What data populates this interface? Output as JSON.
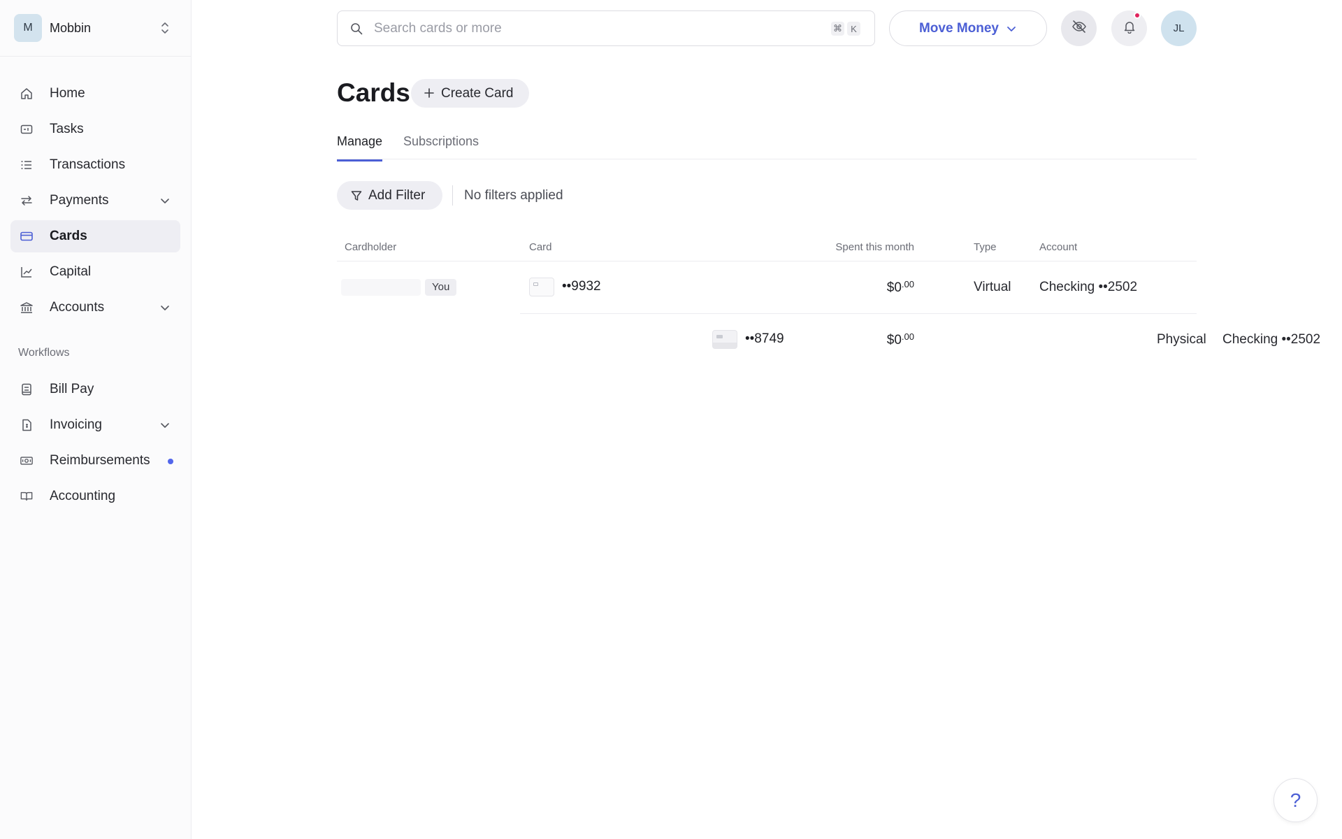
{
  "org": {
    "initial": "M",
    "name": "Mobbin"
  },
  "sidebar": {
    "items": [
      {
        "label": "Home",
        "icon": "home-icon"
      },
      {
        "label": "Tasks",
        "icon": "tasks-icon"
      },
      {
        "label": "Transactions",
        "icon": "list-icon"
      },
      {
        "label": "Payments",
        "icon": "arrows-icon",
        "expandable": true
      },
      {
        "label": "Cards",
        "icon": "card-icon",
        "active": true
      },
      {
        "label": "Capital",
        "icon": "chart-line-icon"
      },
      {
        "label": "Accounts",
        "icon": "bank-icon",
        "expandable": true
      }
    ],
    "section_label": "Workflows",
    "workflows": [
      {
        "label": "Bill Pay",
        "icon": "bill-icon"
      },
      {
        "label": "Invoicing",
        "icon": "invoice-icon",
        "expandable": true
      },
      {
        "label": "Reimbursements",
        "icon": "reimburse-icon",
        "badge_dot": true
      },
      {
        "label": "Accounting",
        "icon": "book-icon"
      }
    ]
  },
  "topbar": {
    "search_placeholder": "Search cards or more",
    "shortcut_keys": [
      "⌘",
      "K"
    ],
    "move_money_label": "Move Money",
    "user_initials": "JL"
  },
  "page": {
    "title": "Cards",
    "create_button": "Create Card",
    "tabs": [
      "Manage",
      "Subscriptions"
    ],
    "active_tab": "Manage",
    "filter_button": "Add Filter",
    "filter_status": "No filters applied"
  },
  "table": {
    "columns": [
      "Cardholder",
      "Card",
      "Spent this month",
      "Type",
      "Account"
    ],
    "rows": [
      {
        "cardholder_badge": "You",
        "card": "••9932",
        "amount_main": "$0",
        "amount_cents": ".00",
        "type": "Virtual",
        "account": "Checking ••2502"
      },
      {
        "cardholder_badge": "",
        "card": "••8749",
        "amount_main": "$0",
        "amount_cents": ".00",
        "type": "Physical",
        "account": "Checking ••2502"
      }
    ]
  },
  "help_label": "?",
  "colors": {
    "accent": "#4c5fd5",
    "notification_dot": "#e0245e",
    "active_nav_bg": "#eeeef3"
  }
}
